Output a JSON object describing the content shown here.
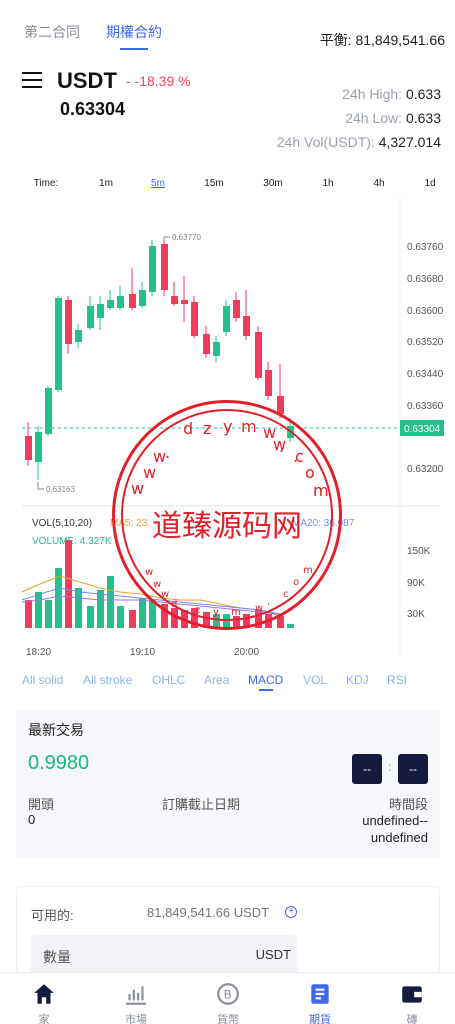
{
  "tabs": [
    "第二合同",
    "期權合約"
  ],
  "balance": "平衡: 81,849,541.66",
  "symbol": "USDT",
  "change": "- -18.39 %",
  "last_price": "0.63304",
  "stats": {
    "high_label": "24h High:",
    "high_value": "0.633",
    "low_label": "24h Low:",
    "low_value": "0.633",
    "vol_label": "24h Vol(USDT):",
    "vol_value": "4,327.014"
  },
  "timeframes": [
    "Time:",
    "1m",
    "5m",
    "15m",
    "30m",
    "1h",
    "4h",
    "1d"
  ],
  "active_timeframe": "5m",
  "chart_labels": {
    "y_ticks": [
      "0.63760",
      "0.63680",
      "0.63600",
      "0.63520",
      "0.63440",
      "0.63360",
      "0.63200"
    ],
    "current_price": "0.63304",
    "max_label": "0.63770",
    "min_label": "0.63163",
    "vol_header": "VOL(5,10,20)",
    "ma5": "MA5: 23.",
    "ma_right": "MA20: 36.087",
    "volume": "VOLUME: 4.327K",
    "vol_ticks": [
      "150K",
      "90K",
      "30K"
    ],
    "x_ticks": [
      "18:20",
      "19:10",
      "20:00"
    ]
  },
  "indicators": [
    "All solid",
    "All stroke",
    "OHLC",
    "Area",
    "MACD",
    "VOL",
    "KDJ",
    "RSI"
  ],
  "active_indicator": "MACD",
  "trade": {
    "title": "最新交易",
    "price": "0.9980",
    "box1": "--",
    "colon": ":",
    "box2": "--",
    "open_label": "開頭",
    "open_value": "0",
    "deadline_label": "訂購截止日期",
    "period_label": "時間段",
    "period_value_1": "undefined--",
    "period_value_2": "undefined"
  },
  "available": {
    "label": "可用的:",
    "value": "81,849,541.66 USDT",
    "plus": "+",
    "qty_placeholder": "數量",
    "qty_unit": "USDT"
  },
  "nav": [
    "家",
    "市場",
    "貨幣",
    "期貨",
    "磚"
  ],
  "watermark": {
    "text": "道臻源码网",
    "top": [
      "d",
      "z",
      "y",
      "m",
      "w",
      "w",
      "."
    ],
    "right": [
      ".",
      "c",
      "o",
      "m"
    ],
    "left": [
      "w",
      "w",
      "w",
      "."
    ],
    "bottom": [
      "w",
      "w",
      "w",
      "d",
      "z",
      "y",
      "m",
      "w",
      ".",
      "c",
      "o",
      "m"
    ]
  },
  "colors": {
    "up": "#26c08c",
    "down": "#f23a5c",
    "accent": "#3f67f0",
    "watermark": "#e3202a"
  }
}
